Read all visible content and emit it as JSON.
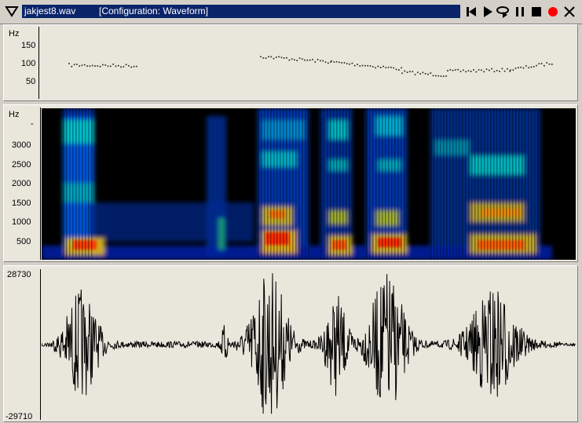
{
  "window": {
    "filename": "jakjest8.wav",
    "configuration": "[Configuration: Waveform]"
  },
  "toolbar": {
    "icons": [
      "skip-start-icon",
      "play-icon",
      "loop-play-icon",
      "pause-icon",
      "stop-icon",
      "record-icon",
      "close-icon"
    ],
    "record_color": "#ff0000"
  },
  "pitch_panel": {
    "unit": "Hz",
    "ticks": [
      "150",
      "100",
      "50"
    ]
  },
  "spectrogram_panel": {
    "unit": "Hz",
    "ticks": [
      "-",
      "3000",
      "2500",
      "2000",
      "1500",
      "1000",
      "500"
    ]
  },
  "waveform_panel": {
    "max_label": "28730",
    "min_label": "-29710"
  }
}
